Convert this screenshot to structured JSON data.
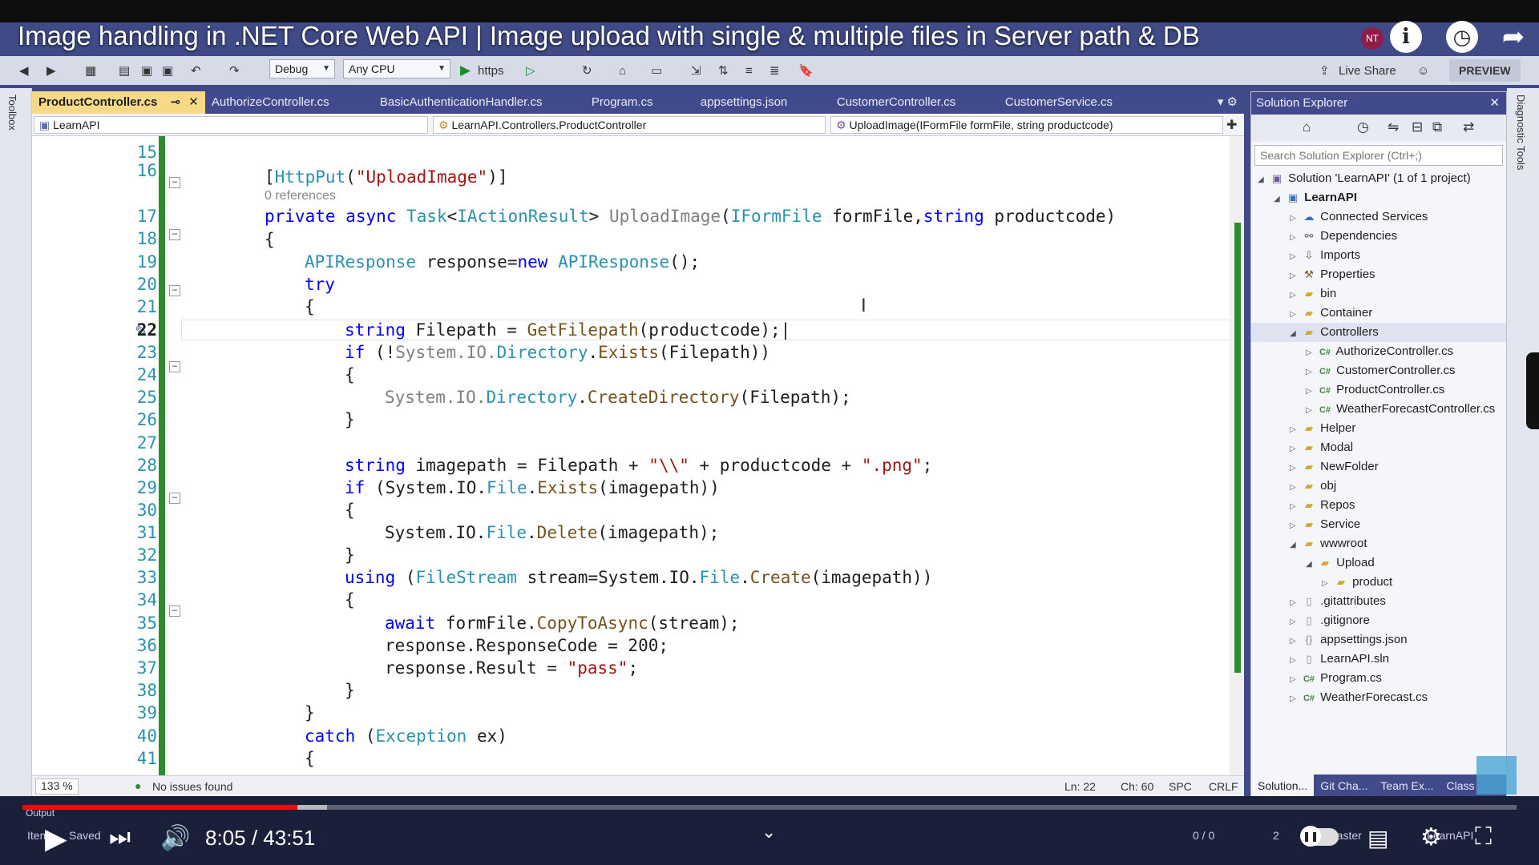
{
  "video": {
    "title": "Image handling in .NET Core Web API | Image upload with single & multiple files in Server path & DB",
    "time": "8:05 / 43:51",
    "progress": 0.184,
    "buffered": 0.204,
    "channel_badge": "NT"
  },
  "ide": {
    "toolbar": {
      "config": "Debug",
      "platform": "Any CPU",
      "run_target": "https",
      "live_share": "Live Share",
      "preview": "PREVIEW"
    },
    "left_strip_label": "Toolbox",
    "right_strip_label": "Diagnostic Tools",
    "tabs": [
      {
        "label": "ProductController.cs",
        "active": true
      },
      {
        "label": "AuthorizeController.cs"
      },
      {
        "label": "BasicAuthenticationHandler.cs"
      },
      {
        "label": "Program.cs"
      },
      {
        "label": "appsettings.json"
      },
      {
        "label": "CustomerController.cs"
      },
      {
        "label": "CustomerService.cs"
      }
    ],
    "nav": {
      "project": "LearnAPI",
      "class": "LearnAPI.Controllers.ProductController",
      "member": "UploadImage(IFormFile formFile, string productcode)"
    },
    "code": {
      "references": "0 references",
      "current_line": "22",
      "lines": [
        "15",
        "16",
        "17",
        "18",
        "19",
        "20",
        "21",
        "22",
        "23",
        "24",
        "25",
        "26",
        "27",
        "28",
        "29",
        "30",
        "31",
        "32",
        "33",
        "34",
        "35",
        "36",
        "37",
        "38",
        "39",
        "40",
        "41"
      ]
    },
    "status": {
      "zoom": "133 %",
      "issues": "No issues found",
      "ln": "Ln: 22",
      "ch": "Ch: 60",
      "spc": "SPC",
      "crlf": "CRLF"
    },
    "solution_explorer": {
      "title": "Solution Explorer",
      "search_placeholder": "Search Solution Explorer (Ctrl+;)",
      "items": [
        {
          "label": "Solution 'LearnAPI' (1 of 1 project)",
          "depth": 0,
          "icon": "solution-icon"
        },
        {
          "label": "LearnAPI",
          "depth": 1,
          "icon": "project-icon",
          "bold": true
        },
        {
          "label": "Connected Services",
          "depth": 2,
          "icon": "connected-services-icon"
        },
        {
          "label": "Dependencies",
          "depth": 2,
          "icon": "dependencies-icon"
        },
        {
          "label": "Imports",
          "depth": 2,
          "icon": "imports-icon"
        },
        {
          "label": "Properties",
          "depth": 2,
          "icon": "properties-icon"
        },
        {
          "label": "bin",
          "depth": 2,
          "icon": "folder-icon"
        },
        {
          "label": "Container",
          "depth": 2,
          "icon": "folder-icon"
        },
        {
          "label": "Controllers",
          "depth": 2,
          "icon": "folder-icon",
          "selected": true
        },
        {
          "label": "AuthorizeController.cs",
          "depth": 3,
          "icon": "csharp-file-icon"
        },
        {
          "label": "CustomerController.cs",
          "depth": 3,
          "icon": "csharp-file-icon"
        },
        {
          "label": "ProductController.cs",
          "depth": 3,
          "icon": "csharp-file-icon"
        },
        {
          "label": "WeatherForecastController.cs",
          "depth": 3,
          "icon": "csharp-file-icon"
        },
        {
          "label": "Helper",
          "depth": 2,
          "icon": "folder-icon"
        },
        {
          "label": "Modal",
          "depth": 2,
          "icon": "folder-icon"
        },
        {
          "label": "NewFolder",
          "depth": 2,
          "icon": "folder-icon"
        },
        {
          "label": "obj",
          "depth": 2,
          "icon": "folder-icon"
        },
        {
          "label": "Repos",
          "depth": 2,
          "icon": "folder-icon"
        },
        {
          "label": "Service",
          "depth": 2,
          "icon": "folder-icon"
        },
        {
          "label": "wwwroot",
          "depth": 2,
          "icon": "folder-icon"
        },
        {
          "label": "Upload",
          "depth": 3,
          "icon": "folder-icon"
        },
        {
          "label": "product",
          "depth": 4,
          "icon": "folder-icon"
        },
        {
          "label": ".gitattributes",
          "depth": 2,
          "icon": "file-icon"
        },
        {
          "label": ".gitignore",
          "depth": 2,
          "icon": "file-icon"
        },
        {
          "label": "appsettings.json",
          "depth": 2,
          "icon": "json-file-icon"
        },
        {
          "label": "LearnAPI.sln",
          "depth": 2,
          "icon": "file-icon"
        },
        {
          "label": "Program.cs",
          "depth": 2,
          "icon": "csharp-file-icon"
        },
        {
          "label": "WeatherForecast.cs",
          "depth": 2,
          "icon": "csharp-file-icon"
        }
      ],
      "bottom_tabs": [
        "Solution...",
        "Git Cha...",
        "Team Ex...",
        "Class"
      ]
    },
    "bottom_status": {
      "saved": "Saved",
      "item": "Item",
      "output": "Output",
      "errors": "0 / 0",
      "commits": "2",
      "branch": "master",
      "repo": "LearnAPI"
    }
  }
}
